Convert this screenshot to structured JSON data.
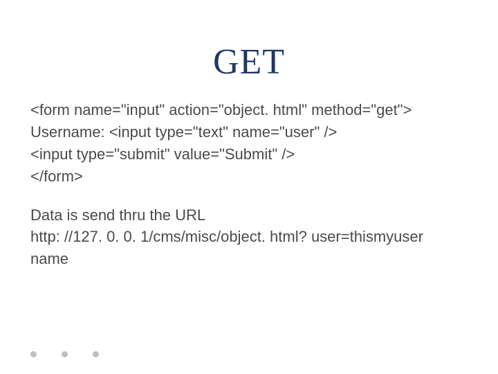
{
  "title": "GET",
  "code": {
    "line1": "<form name=\"input\" action=\"object. html\" method=\"get\">",
    "line2": "Username: <input type=\"text\" name=\"user\" />",
    "line3": "<input type=\"submit\" value=\"Submit\" />",
    "line4": "</form>"
  },
  "explain": {
    "line1": "Data is send thru the URL",
    "line2": "http: //127. 0. 0. 1/cms/misc/object. html? user=thismyuser",
    "line3": "name"
  }
}
